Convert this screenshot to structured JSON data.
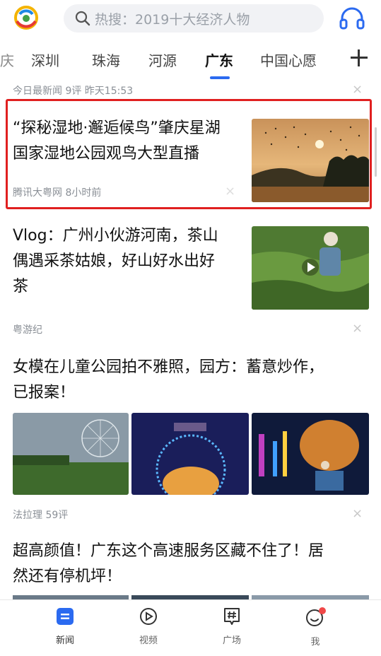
{
  "header": {
    "search_placeholder": "热搜：2019十大经济人物"
  },
  "tabs": [
    "庆",
    "深圳",
    "珠海",
    "河源",
    "广东",
    "中国心愿"
  ],
  "active_tab": "广东",
  "feed": {
    "top_meta": "今日最新闻  9评  昨天15:53",
    "item1": {
      "title_line1": "“探秘湿地·邂逅候鸟”肇庆星湖",
      "title_line2": "国家湿地公园观鸟大型直播",
      "meta": "腾讯大粤网  8小时前"
    },
    "item2": {
      "title_line1": "Vlog：广州小伙游河南，茶山",
      "title_line2": "偶遇采茶姑娘，好山好水出好",
      "title_line3": "茶",
      "meta": "粤游纪"
    },
    "item3": {
      "title_line1": "女模在儿童公园拍不雅照，园方：蓄意炒作，",
      "title_line2": "已报案！",
      "meta": "法拉理  59评"
    },
    "item4": {
      "title_line1": "超高颜值！广东这个高速服务区藏不住了！居",
      "title_line2": "然还有停机坪！"
    }
  },
  "nav": {
    "news": "新闻",
    "video": "视频",
    "square": "广场",
    "me": "我"
  },
  "colors": {
    "accent": "#2b6af0",
    "highlight_border": "#e02020",
    "notification_dot": "#f04848"
  }
}
